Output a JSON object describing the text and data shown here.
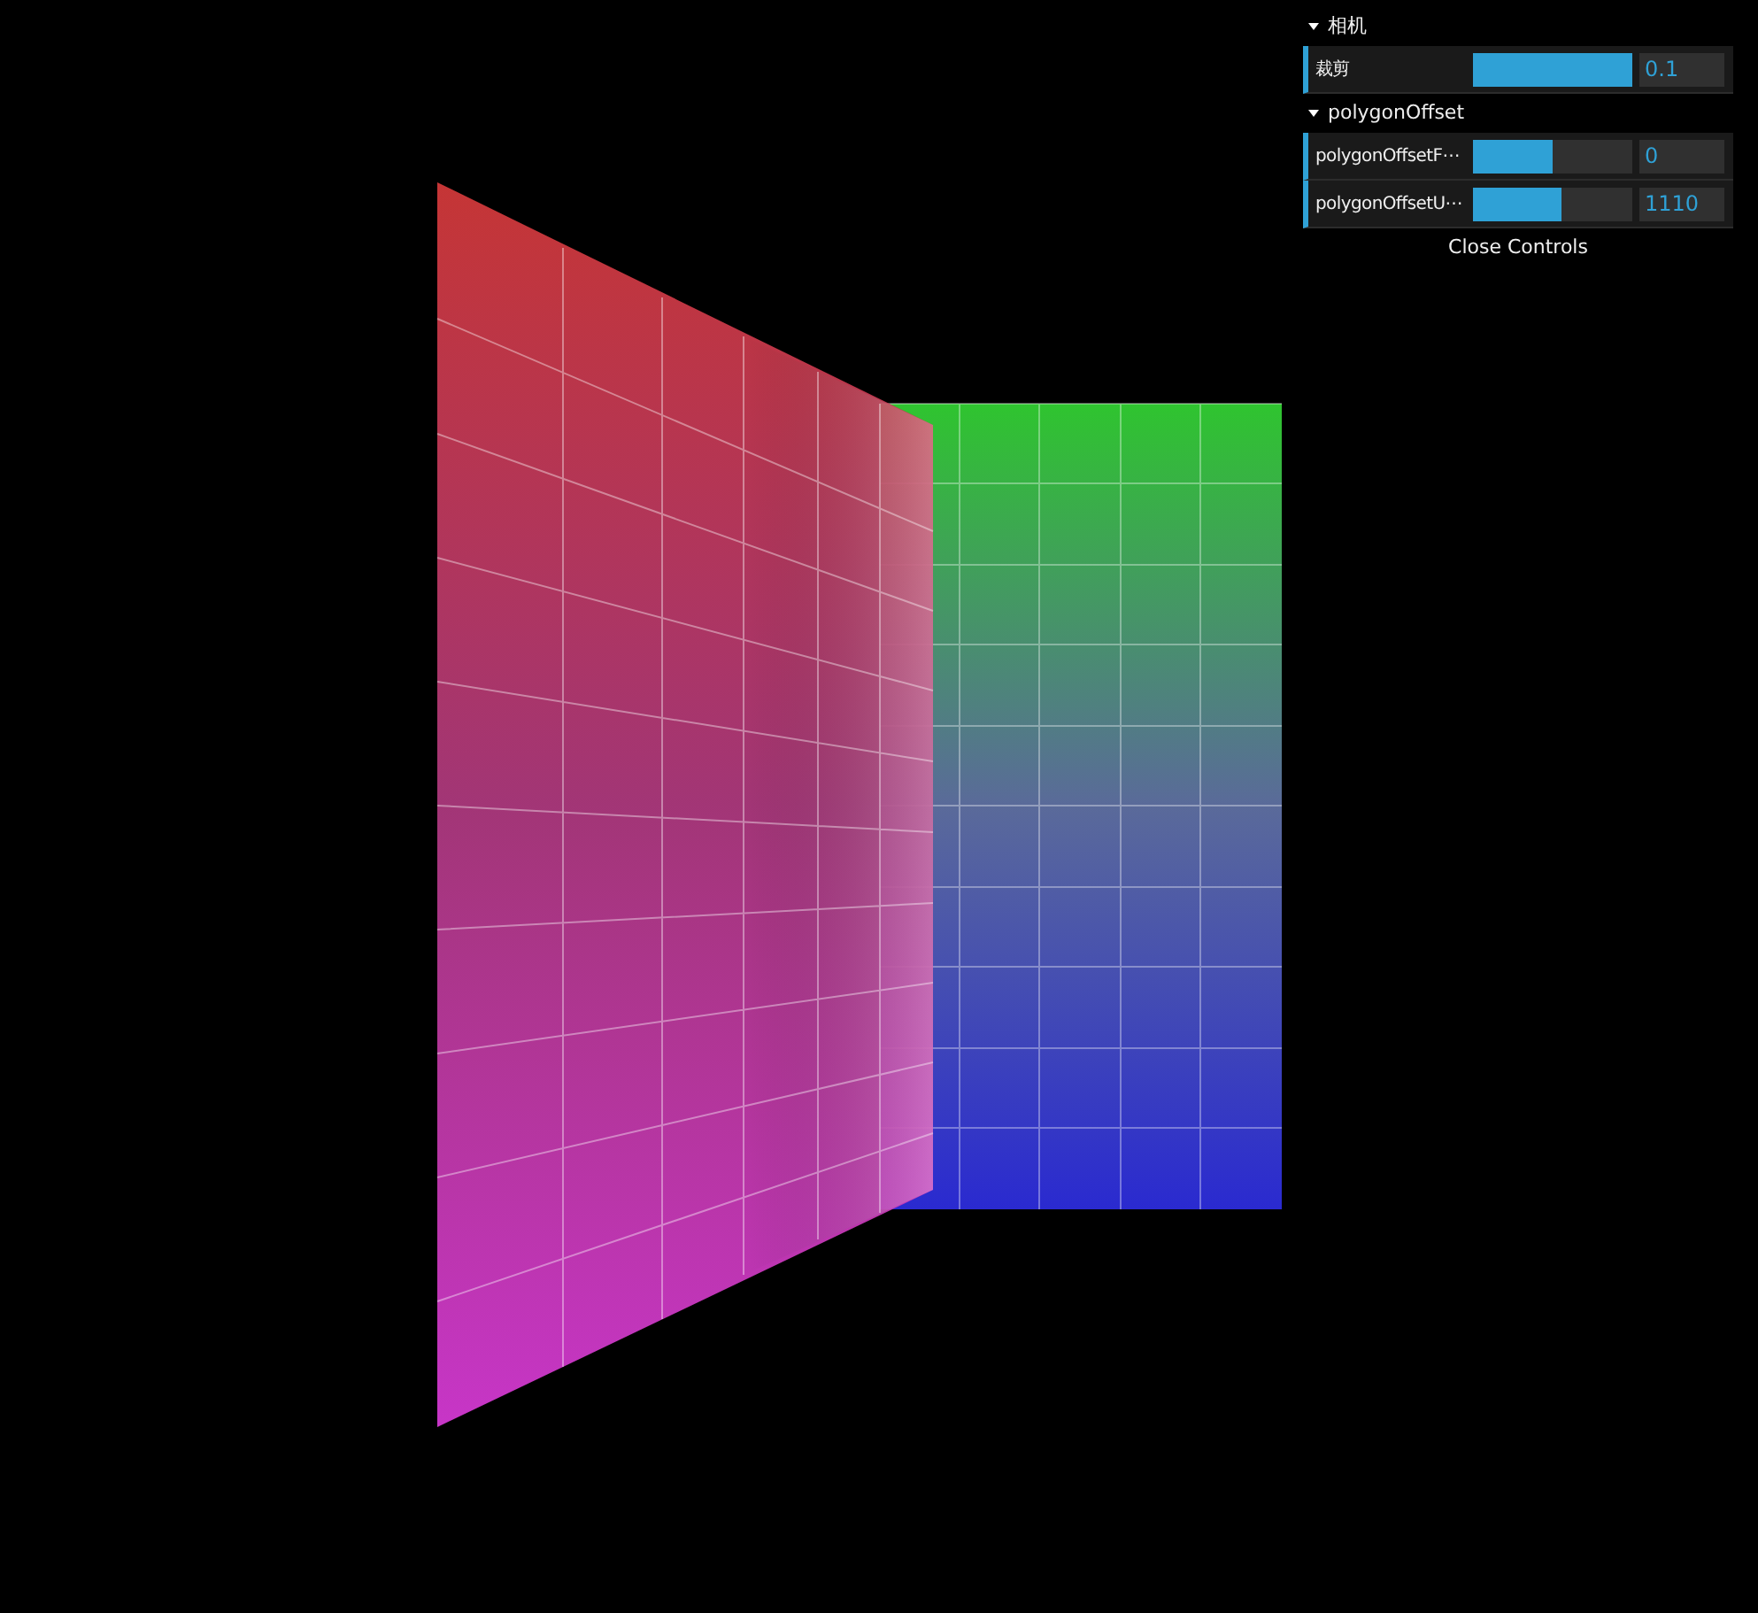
{
  "gui": {
    "folders": [
      {
        "title": "相机",
        "expanded": true,
        "controls": [
          {
            "label": "裁剪",
            "level": 1.0,
            "value": "0.1"
          }
        ]
      },
      {
        "title": "polygonOffset",
        "expanded": true,
        "controls": [
          {
            "label": "polygonOffsetF⋯",
            "level": 0.5,
            "value": "0"
          },
          {
            "label": "polygonOffsetU⋯",
            "level": 0.56,
            "value": "1110"
          }
        ]
      }
    ],
    "close_button": "Close Controls"
  }
}
